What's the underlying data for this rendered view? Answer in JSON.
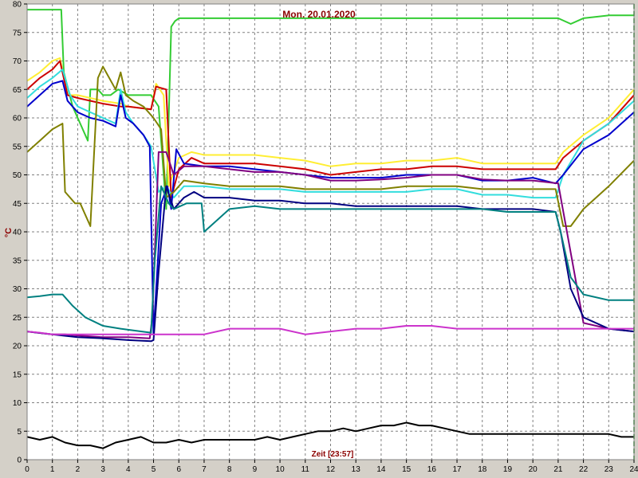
{
  "chart_data": {
    "type": "line",
    "title": "Mon. 20.01.2020",
    "xlabel": "Zeit [23:57]",
    "ylabel": "°C",
    "xlim": [
      0,
      24
    ],
    "ylim": [
      0,
      80
    ],
    "x_ticks": [
      0,
      1,
      2,
      3,
      4,
      5,
      6,
      7,
      8,
      9,
      10,
      11,
      12,
      13,
      14,
      15,
      16,
      17,
      18,
      19,
      20,
      21,
      22,
      23,
      24
    ],
    "y_ticks": [
      0,
      5,
      10,
      15,
      20,
      25,
      30,
      35,
      40,
      45,
      50,
      55,
      60,
      65,
      70,
      75,
      80
    ],
    "grid": true,
    "background": "#ffffff",
    "plot_border": "#808080",
    "grid_color": "#808080",
    "now_marker_color": "#008000",
    "series": [
      {
        "color": "#33cc33",
        "x": [
          0,
          0.5,
          1.0,
          1.35,
          1.45,
          1.8,
          2.1,
          2.4,
          2.5,
          2.8,
          3.0,
          3.3,
          3.6,
          4.0,
          4.5,
          4.9,
          5.2,
          5.5,
          5.7,
          5.85,
          6.0,
          7,
          8,
          9,
          10,
          11,
          12,
          13,
          14,
          15,
          16,
          17,
          18,
          19,
          20,
          21,
          21.5,
          22,
          23,
          24
        ],
        "y": [
          79,
          79,
          79,
          79,
          68,
          62,
          59,
          56,
          65,
          65,
          64,
          64,
          65,
          64,
          64,
          64,
          62,
          44,
          76,
          77,
          77.5,
          77.5,
          77.5,
          77.5,
          77.5,
          77.5,
          77.5,
          77.5,
          77.5,
          77.5,
          77.5,
          77.5,
          77.5,
          77.5,
          77.5,
          77.5,
          76.5,
          77.5,
          78,
          78
        ]
      },
      {
        "color": "#ffee33",
        "x": [
          0,
          0.5,
          1.0,
          1.3,
          1.6,
          2.0,
          3.0,
          3.7,
          4.0,
          4.9,
          5.1,
          5.4,
          5.6,
          6.0,
          6.5,
          7,
          8,
          9,
          10,
          11,
          12,
          13,
          14,
          15,
          16,
          17,
          18,
          19,
          20,
          20.9,
          21.2,
          22,
          23,
          24
        ],
        "y": [
          66.5,
          68,
          70,
          70.5,
          64,
          64,
          63,
          62.5,
          62,
          61.5,
          66,
          64,
          48,
          53,
          54,
          53.5,
          53.5,
          53.5,
          53,
          52.5,
          51.5,
          52,
          52,
          52.5,
          52.5,
          53,
          52,
          52,
          52,
          52,
          54,
          57,
          60,
          65
        ]
      },
      {
        "color": "#cc0000",
        "x": [
          0,
          0.5,
          1.0,
          1.3,
          1.6,
          2.0,
          3.0,
          3.7,
          4.0,
          4.9,
          5.1,
          5.5,
          5.7,
          6.0,
          6.5,
          7,
          8,
          9,
          10,
          11,
          12,
          13,
          14,
          15,
          16,
          17,
          18,
          19,
          20,
          20.9,
          21.2,
          22,
          23,
          24
        ],
        "y": [
          65,
          67,
          68.5,
          70,
          64,
          63.5,
          62.5,
          62,
          62,
          61.5,
          65.5,
          65,
          46,
          51,
          53,
          52,
          52,
          52,
          51.5,
          51,
          50,
          50.5,
          51,
          51,
          51.5,
          51.5,
          51,
          51,
          51,
          51,
          53,
          56,
          59,
          64
        ]
      },
      {
        "color": "#33dddd",
        "x": [
          0,
          0.5,
          1.0,
          1.4,
          1.7,
          2.0,
          2.5,
          3.0,
          3.5,
          3.7,
          3.9,
          4.2,
          4.6,
          4.9,
          5.2,
          5.5,
          5.8,
          6.2,
          7,
          8,
          9,
          10,
          11,
          12,
          13,
          14,
          15,
          16,
          17,
          18,
          19,
          20,
          20.9,
          21.2,
          22,
          23,
          24
        ],
        "y": [
          63.5,
          65.5,
          67,
          68.5,
          64,
          62,
          61,
          60,
          59,
          65,
          61,
          59,
          57,
          55,
          47,
          48,
          46,
          48,
          48,
          47.5,
          47.5,
          47.5,
          47,
          47,
          47,
          47,
          47,
          47.5,
          47.5,
          46.5,
          46.5,
          46,
          46,
          50,
          56,
          59,
          63
        ]
      },
      {
        "color": "#0000cc",
        "x": [
          0,
          0.5,
          1.0,
          1.4,
          1.6,
          2.0,
          2.5,
          3.0,
          3.5,
          3.7,
          3.9,
          4.2,
          4.6,
          4.85,
          5.0,
          5.3,
          5.55,
          5.7,
          5.9,
          6.2,
          7,
          8,
          9,
          10,
          11,
          12,
          13,
          14,
          15,
          16,
          17,
          18,
          19,
          20,
          20.9,
          21.2,
          22,
          23,
          24
        ],
        "y": [
          62,
          64,
          66,
          66.5,
          63,
          61,
          60,
          59.5,
          58.5,
          64,
          60,
          59,
          57,
          55,
          22,
          45,
          48,
          44,
          54.5,
          52,
          51.5,
          51.5,
          51,
          50.5,
          50,
          49.5,
          49.5,
          49.5,
          50,
          50,
          50,
          49,
          49,
          49.5,
          48.5,
          50,
          54.5,
          57,
          61
        ]
      },
      {
        "color": "#808000",
        "x": [
          0,
          0.5,
          1.0,
          1.4,
          1.5,
          1.9,
          2.1,
          2.5,
          2.8,
          3.0,
          3.5,
          3.7,
          3.9,
          4.2,
          4.6,
          5.0,
          5.3,
          5.5,
          5.8,
          6.2,
          7,
          8,
          9,
          10,
          11,
          12,
          13,
          14,
          15,
          16,
          17,
          18,
          19,
          20,
          20.9,
          21.2,
          21.5,
          22,
          23,
          24
        ],
        "y": [
          54,
          56,
          58,
          59,
          47,
          45,
          45,
          41,
          67,
          69,
          65,
          68,
          64,
          63,
          62,
          60,
          58,
          46,
          47,
          49,
          48.5,
          48,
          48,
          48,
          47.5,
          47.5,
          47.5,
          47.5,
          48,
          48,
          48,
          47.5,
          47.5,
          47.5,
          47.5,
          41,
          41,
          44,
          48,
          52.5
        ]
      },
      {
        "color": "#800080",
        "x": [
          0,
          1.0,
          1.5,
          2.0,
          3.0,
          4.0,
          4.85,
          4.95,
          5.2,
          5.5,
          5.8,
          6.2,
          7,
          8,
          9,
          10,
          11,
          12,
          13,
          14,
          15,
          16,
          17,
          18,
          19,
          20,
          21,
          22,
          23,
          24
        ],
        "y": [
          22.5,
          22,
          22,
          21.8,
          21.5,
          21.5,
          21.3,
          25,
          54,
          54,
          50,
          51.5,
          51.5,
          51,
          50.5,
          50.5,
          50,
          49,
          49,
          49.2,
          49.5,
          50,
          50,
          49.2,
          49,
          49,
          48.5,
          24,
          23,
          22.5
        ]
      },
      {
        "color": "#000080",
        "x": [
          0,
          1.0,
          2.0,
          3.0,
          4.0,
          4.9,
          5.0,
          5.2,
          5.5,
          5.8,
          6.2,
          6.6,
          7,
          8,
          9,
          10,
          11,
          12,
          13,
          14,
          15,
          16,
          17,
          18,
          19,
          20,
          20.9,
          21.1,
          21.5,
          22,
          23,
          24
        ],
        "y": [
          22.5,
          22,
          21.5,
          21.3,
          21,
          20.8,
          21,
          33,
          48,
          44,
          46,
          47,
          46,
          46,
          45.5,
          45.5,
          45,
          45,
          44.5,
          44.5,
          44.5,
          44.5,
          44.5,
          44,
          44,
          44,
          43.5,
          40,
          30,
          25,
          23,
          22.5
        ]
      },
      {
        "color": "#008080",
        "x": [
          0,
          0.5,
          1.0,
          1.4,
          1.8,
          2.3,
          3.0,
          3.7,
          4.2,
          4.9,
          5.05,
          5.3,
          5.6,
          5.8,
          6.3,
          6.9,
          7,
          8,
          9,
          10,
          11,
          12,
          13,
          14,
          15,
          16,
          17,
          18,
          19,
          20,
          20.9,
          21.1,
          21.5,
          22,
          23,
          24
        ],
        "y": [
          28.5,
          28.7,
          29,
          29,
          27,
          25,
          23.5,
          23,
          22.7,
          22.3,
          35,
          48,
          45,
          44,
          45,
          45,
          40,
          44,
          44.5,
          44,
          44,
          44,
          44,
          44,
          44,
          44,
          44,
          44,
          43.5,
          43.5,
          43.5,
          40,
          32,
          29,
          28,
          28
        ]
      },
      {
        "color": "#cc33cc",
        "x": [
          0,
          0.5,
          1.0,
          2.0,
          3.0,
          4.0,
          5.0,
          6.0,
          7.0,
          8.0,
          9,
          10,
          11,
          12,
          13,
          14,
          15,
          16,
          17,
          18,
          19,
          20,
          21,
          22,
          23,
          24
        ],
        "y": [
          22.5,
          22.3,
          22,
          22,
          22,
          22,
          22,
          22,
          22,
          23,
          23,
          23,
          22,
          22.5,
          23,
          23,
          23.5,
          23.5,
          23,
          23,
          23,
          23,
          23,
          23,
          23,
          23
        ]
      },
      {
        "color": "#000000",
        "x": [
          0,
          0.5,
          1.0,
          1.5,
          2.0,
          2.5,
          3.0,
          3.5,
          4.0,
          4.5,
          5.0,
          5.5,
          6.0,
          6.5,
          7,
          7.5,
          8,
          8.5,
          9,
          9.5,
          10,
          10.5,
          11,
          11.5,
          12,
          12.5,
          13,
          13.5,
          14,
          14.5,
          15,
          15.5,
          16,
          16.5,
          17,
          17.5,
          18,
          18.5,
          19,
          19.5,
          20,
          20.5,
          21,
          21.5,
          22,
          22.5,
          23,
          23.5,
          24
        ],
        "y": [
          4,
          3.5,
          4,
          3,
          2.5,
          2.5,
          2,
          3,
          3.5,
          4,
          3,
          3,
          3.5,
          3,
          3.5,
          3.5,
          3.5,
          3.5,
          3.5,
          4,
          3.5,
          4,
          4.5,
          5,
          5,
          5.5,
          5,
          5.5,
          6,
          6,
          6.5,
          6,
          6,
          5.5,
          5,
          4.5,
          4.5,
          4.5,
          4.5,
          4.5,
          4.5,
          4.5,
          4.5,
          4.5,
          4.5,
          4.5,
          4.5,
          4,
          4
        ]
      }
    ]
  }
}
